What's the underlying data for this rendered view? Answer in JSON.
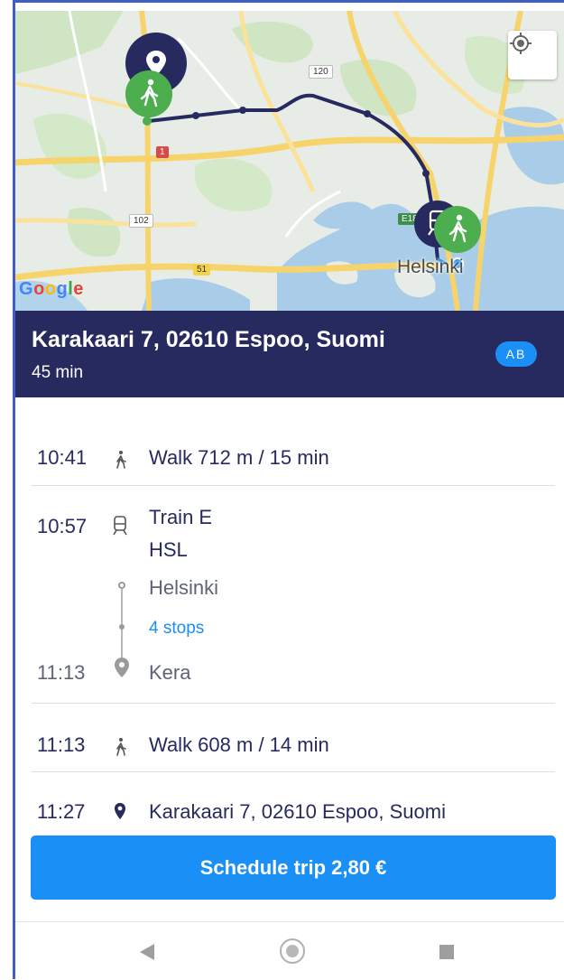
{
  "map": {
    "road_labels": [
      "120",
      "102",
      "51",
      "1",
      "E18"
    ],
    "city_label": "Helsinki",
    "google_logo": [
      "G",
      "o",
      "o",
      "g",
      "l",
      "e"
    ],
    "google_colors": [
      "#4285F4",
      "#EA4335",
      "#FBBC05",
      "#4285F4",
      "#34A853",
      "#EA4335"
    ],
    "locate_icon": "gps-target-icon"
  },
  "destination": {
    "title": "Karakaari 7, 02610 Espoo, Suomi",
    "duration": "45 min",
    "zone": "AB"
  },
  "itinerary": {
    "legs": [
      {
        "time": "10:41",
        "icon": "walk-icon",
        "text": "Walk 712 m / 15 min"
      },
      {
        "time": "10:57",
        "icon": "train-icon",
        "line1": "Train E",
        "line2": "HSL",
        "from": "Helsinki",
        "stops": "4 stops",
        "end_time": "11:13",
        "to": "Kera"
      },
      {
        "time": "11:13",
        "icon": "walk-icon",
        "text": "Walk 608 m / 14 min"
      },
      {
        "time": "11:27",
        "icon": "location-pin-icon",
        "text": "Karakaari 7, 02610 Espoo, Suomi"
      }
    ]
  },
  "actions": {
    "schedule_label": "Schedule trip 2,80 €"
  },
  "colors": {
    "header_bg": "#272a5f",
    "accent": "#1a8ff5",
    "walk_marker": "#4cae4f",
    "route": "#272a5f"
  }
}
